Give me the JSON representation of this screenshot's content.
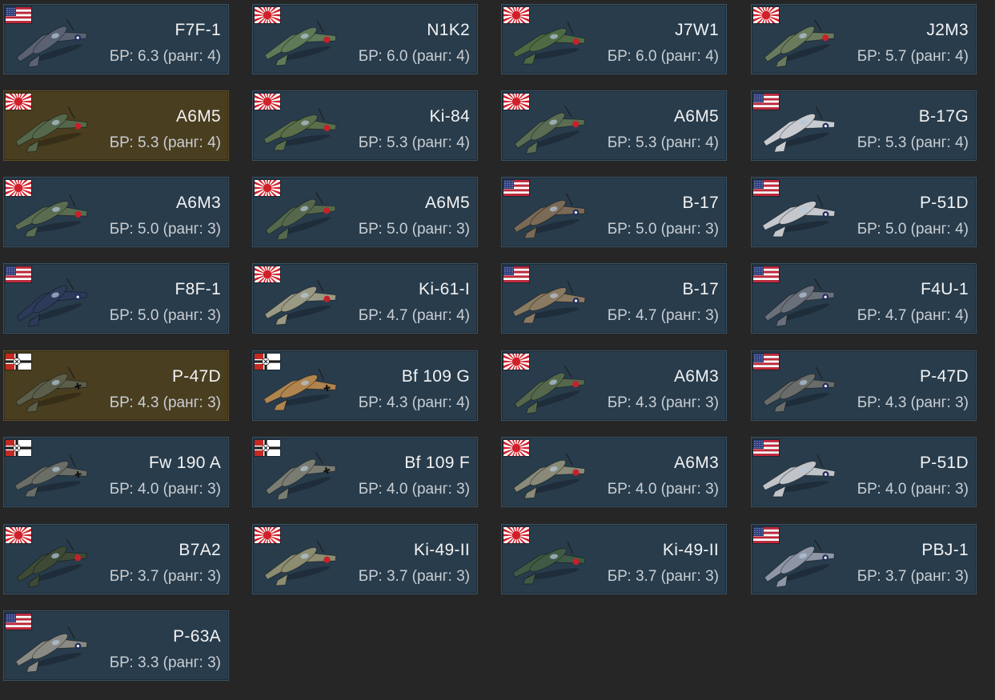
{
  "vehicles": [
    {
      "name": "F7F-1",
      "br": "БР: 6.3 (ранг: 4)",
      "nation": "usa",
      "flag_icon": "usa-flag-icon",
      "plane_color": "#5a6272",
      "highlighted": false
    },
    {
      "name": "N1K2",
      "br": "БР: 6.0 (ранг: 4)",
      "nation": "japan",
      "flag_icon": "japan-flag-icon",
      "plane_color": "#5e7a58",
      "highlighted": false
    },
    {
      "name": "J7W1",
      "br": "БР: 6.0 (ранг: 4)",
      "nation": "japan",
      "flag_icon": "japan-flag-icon",
      "plane_color": "#4e6a44",
      "highlighted": false
    },
    {
      "name": "J2M3",
      "br": "БР: 5.7 (ранг: 4)",
      "nation": "japan",
      "flag_icon": "japan-flag-icon",
      "plane_color": "#6a7a5c",
      "highlighted": false
    },
    {
      "name": "A6M5",
      "br": "БР: 5.3 (ранг: 4)",
      "nation": "japan",
      "flag_icon": "japan-flag-icon",
      "plane_color": "#56684c",
      "highlighted": true
    },
    {
      "name": "Ki-84",
      "br": "БР: 5.3 (ранг: 4)",
      "nation": "japan",
      "flag_icon": "japan-flag-icon",
      "plane_color": "#5a6e4a",
      "highlighted": false
    },
    {
      "name": "A6M5",
      "br": "БР: 5.3 (ранг: 4)",
      "nation": "japan",
      "flag_icon": "japan-flag-icon",
      "plane_color": "#5a6c52",
      "highlighted": false
    },
    {
      "name": "B-17G",
      "br": "БР: 5.3 (ранг: 4)",
      "nation": "usa",
      "flag_icon": "usa-flag-icon",
      "plane_color": "#c8ccd0",
      "highlighted": false
    },
    {
      "name": "A6M3",
      "br": "БР: 5.0 (ранг: 3)",
      "nation": "japan",
      "flag_icon": "japan-flag-icon",
      "plane_color": "#5a6c52",
      "highlighted": false
    },
    {
      "name": "A6M5",
      "br": "БР: 5.0 (ранг: 3)",
      "nation": "japan",
      "flag_icon": "japan-flag-icon",
      "plane_color": "#56684c",
      "highlighted": false
    },
    {
      "name": "B-17",
      "br": "БР: 5.0 (ранг: 3)",
      "nation": "usa",
      "flag_icon": "usa-flag-icon",
      "plane_color": "#7a6a56",
      "highlighted": false
    },
    {
      "name": "P-51D",
      "br": "БР: 5.0 (ранг: 4)",
      "nation": "usa",
      "flag_icon": "usa-flag-icon",
      "plane_color": "#c4c8cc",
      "highlighted": false
    },
    {
      "name": "F8F-1",
      "br": "БР: 5.0 (ранг: 3)",
      "nation": "usa",
      "flag_icon": "usa-flag-icon",
      "plane_color": "#2e3a5a",
      "highlighted": false
    },
    {
      "name": "Ki-61-I",
      "br": "БР: 4.7 (ранг: 4)",
      "nation": "japan",
      "flag_icon": "japan-flag-icon",
      "plane_color": "#9a9a84",
      "highlighted": false
    },
    {
      "name": "B-17",
      "br": "БР: 4.7 (ранг: 3)",
      "nation": "usa",
      "flag_icon": "usa-flag-icon",
      "plane_color": "#8a7a62",
      "highlighted": false
    },
    {
      "name": "F4U-1",
      "br": "БР: 4.7 (ранг: 4)",
      "nation": "usa",
      "flag_icon": "usa-flag-icon",
      "plane_color": "#6a707a",
      "highlighted": false
    },
    {
      "name": "P-47D",
      "br": "БР: 4.3 (ранг: 3)",
      "nation": "germany",
      "flag_icon": "germany-flag-icon",
      "plane_color": "#5a5e4a",
      "highlighted": true
    },
    {
      "name": "Bf 109 G",
      "br": "БР: 4.3 (ранг: 4)",
      "nation": "germany",
      "flag_icon": "germany-flag-icon",
      "plane_color": "#b0844e",
      "highlighted": false
    },
    {
      "name": "A6M3",
      "br": "БР: 4.3 (ранг: 3)",
      "nation": "japan",
      "flag_icon": "japan-flag-icon",
      "plane_color": "#56684c",
      "highlighted": false
    },
    {
      "name": "P-47D",
      "br": "БР: 4.3 (ранг: 3)",
      "nation": "usa",
      "flag_icon": "usa-flag-icon",
      "plane_color": "#6a6c6a",
      "highlighted": false
    },
    {
      "name": "Fw 190 A",
      "br": "БР: 4.0 (ранг: 3)",
      "nation": "germany",
      "flag_icon": "germany-flag-icon",
      "plane_color": "#6a6e66",
      "highlighted": false
    },
    {
      "name": "Bf 109 F",
      "br": "БР: 4.0 (ранг: 3)",
      "nation": "germany",
      "flag_icon": "germany-flag-icon",
      "plane_color": "#7a7c72",
      "highlighted": false
    },
    {
      "name": "A6M3",
      "br": "БР: 4.0 (ранг: 3)",
      "nation": "japan",
      "flag_icon": "japan-flag-icon",
      "plane_color": "#8a8a78",
      "highlighted": false
    },
    {
      "name": "P-51D",
      "br": "БР: 4.0 (ранг: 3)",
      "nation": "usa",
      "flag_icon": "usa-flag-icon",
      "plane_color": "#c0c4c8",
      "highlighted": false
    },
    {
      "name": "B7A2",
      "br": "БР: 3.7 (ранг: 3)",
      "nation": "japan",
      "flag_icon": "japan-flag-icon",
      "plane_color": "#3e4a36",
      "highlighted": false
    },
    {
      "name": "Ki-49-II",
      "br": "БР: 3.7 (ранг: 3)",
      "nation": "japan",
      "flag_icon": "japan-flag-icon",
      "plane_color": "#8c8c70",
      "highlighted": false
    },
    {
      "name": "Ki-49-II",
      "br": "БР: 3.7 (ранг: 3)",
      "nation": "japan",
      "flag_icon": "japan-flag-icon",
      "plane_color": "#3e5a44",
      "highlighted": false
    },
    {
      "name": "PBJ-1",
      "br": "БР: 3.7 (ранг: 3)",
      "nation": "usa",
      "flag_icon": "usa-flag-icon",
      "plane_color": "#8e96a6",
      "highlighted": false
    },
    {
      "name": "P-63A",
      "br": "БР: 3.3 (ранг: 3)",
      "nation": "usa",
      "flag_icon": "usa-flag-icon",
      "plane_color": "#8a8a84",
      "highlighted": false
    }
  ]
}
